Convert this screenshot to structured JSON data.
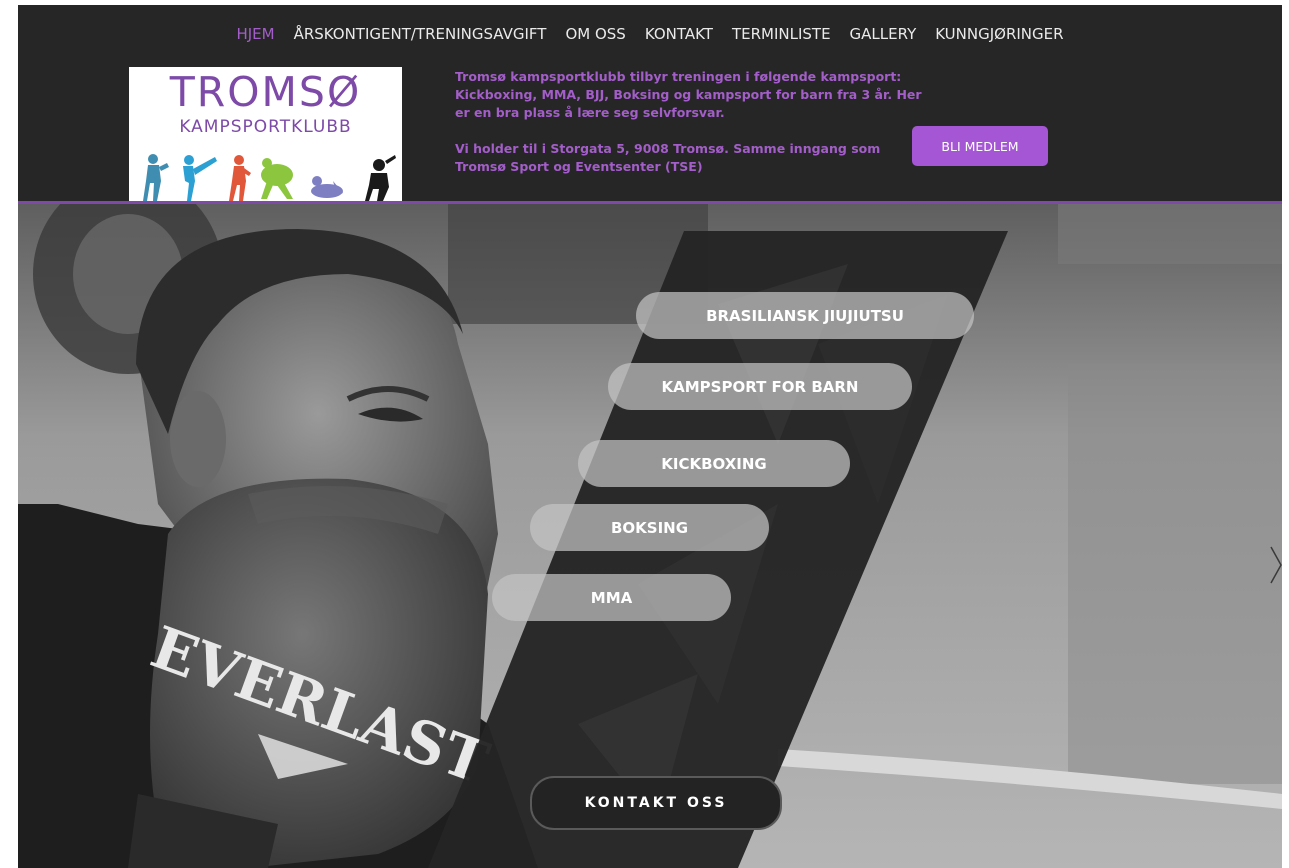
{
  "nav": {
    "items": [
      {
        "label": "HJEM",
        "active": true
      },
      {
        "label": "ÅRSKONTIGENT/TRENINGSAVGIFT",
        "active": false
      },
      {
        "label": "OM OSS",
        "active": false
      },
      {
        "label": "KONTAKT",
        "active": false
      },
      {
        "label": "TERMINLISTE",
        "active": false
      },
      {
        "label": "GALLERY",
        "active": false
      },
      {
        "label": "KUNNGJØRINGER",
        "active": false
      }
    ]
  },
  "logo": {
    "title": "TROMSØ",
    "subtitle": "KAMPSPORTKLUBB"
  },
  "intro": {
    "paragraph1": "Tromsø kampsportklubb tilbyr treningen i følgende kampsport: Kickboxing, MMA, BJJ, Boksing og kampsport for barn fra 3 år. Her er en bra plass å lære seg selvforsvar.",
    "paragraph2": "Vi holder til i Storgata 5, 9008 Tromsø. Samme inngang som Tromsø Sport og Eventsenter (TSE)"
  },
  "join_button": "BLI MEDLEM",
  "hero": {
    "sports": [
      {
        "label": "BRASILIANSK JIUJIUTSU"
      },
      {
        "label": "KAMPSPORT FOR BARN"
      },
      {
        "label": "KICKBOXING"
      },
      {
        "label": "BOKSING"
      },
      {
        "label": "MMA"
      }
    ],
    "contact_button": "KONTAKT OSS",
    "glove_brand": "EVERLAST"
  },
  "colors": {
    "accent": "#a556d4",
    "accent_text": "#a35ec9",
    "header_bg": "#262626"
  },
  "icons": {
    "next": "chevron-right-icon"
  }
}
